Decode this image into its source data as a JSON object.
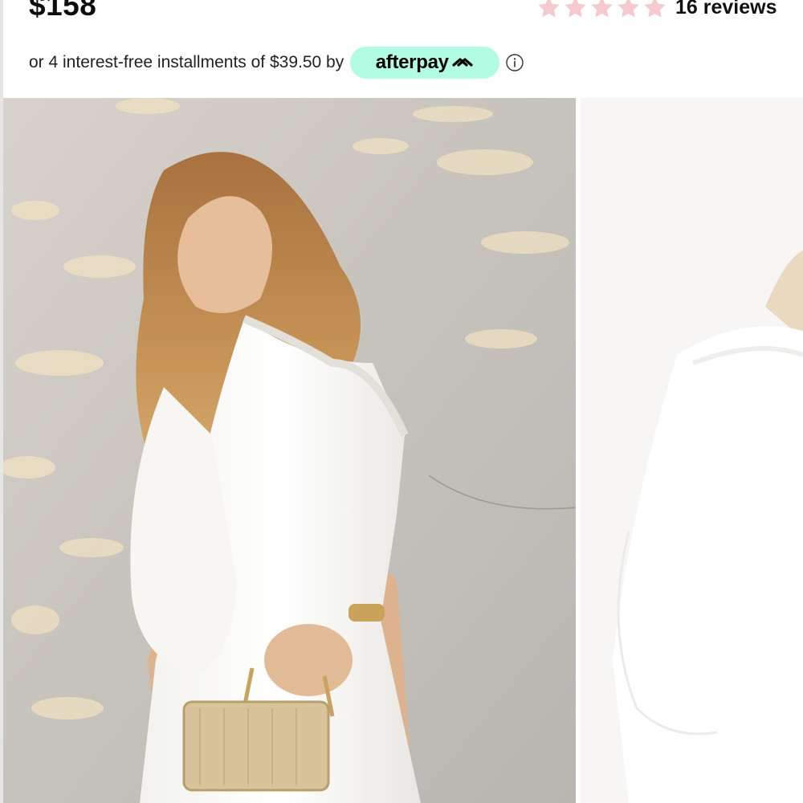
{
  "product": {
    "price": "$158",
    "rating": {
      "stars": 5,
      "filled_stars": 0,
      "star_color": "#f6c9cc",
      "reviews_label": "16 reviews"
    }
  },
  "payment": {
    "installment_text": "or 4 interest-free installments of $39.50 by",
    "provider": "afterpay",
    "badge_color": "#b2fce4",
    "info_icon": "info-circle-icon"
  },
  "gallery": {
    "images": [
      {
        "name": "product-image-main",
        "subject": "model in white one-shoulder dress holding gold handbag"
      },
      {
        "name": "product-image-next",
        "subject": "faded preview of next product photo"
      }
    ]
  }
}
